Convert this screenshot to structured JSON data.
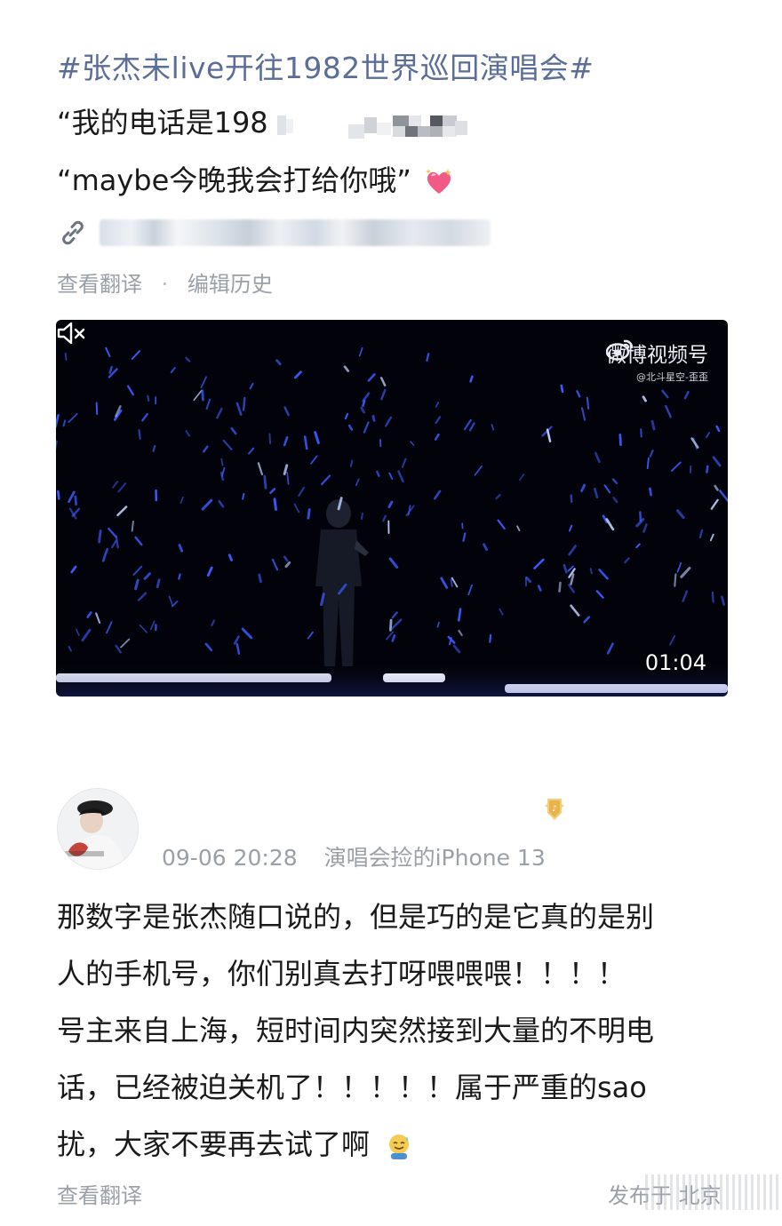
{
  "post": {
    "hashtag": "#张杰未live开往1982世界巡回演唱会#",
    "quote1": "“我的电话是198",
    "quote2": "“maybe今晚我会打给你哦”",
    "meta_translate": "查看翻译",
    "meta_separator": "·",
    "meta_edit_history": "编辑历史"
  },
  "video": {
    "watermark_title": "微博视频号",
    "watermark_sub": "@北斗星空-歪歪",
    "duration": "01:04",
    "muted": true
  },
  "comment": {
    "timestamp": "09-06 20:28",
    "source": "演唱会捡的iPhone 13",
    "lines": [
      "那数字是张杰随口说的，但是巧的是它真的是别",
      "人的手机号，你们别真去打呀喂喂喂！！！！",
      "号主来自上海，短时间内突然接到大量的不明电",
      "话，已经被迫关机了！！！！！属于严重的sao",
      "扰，大家不要再去试了啊"
    ],
    "translate": "查看翻译",
    "location": "发布于 北京"
  },
  "colors": {
    "hashtag": "#5b6e98",
    "meta": "#9aa0a8",
    "video_bg": "#02030a",
    "glowstick": "#3b5bff"
  }
}
